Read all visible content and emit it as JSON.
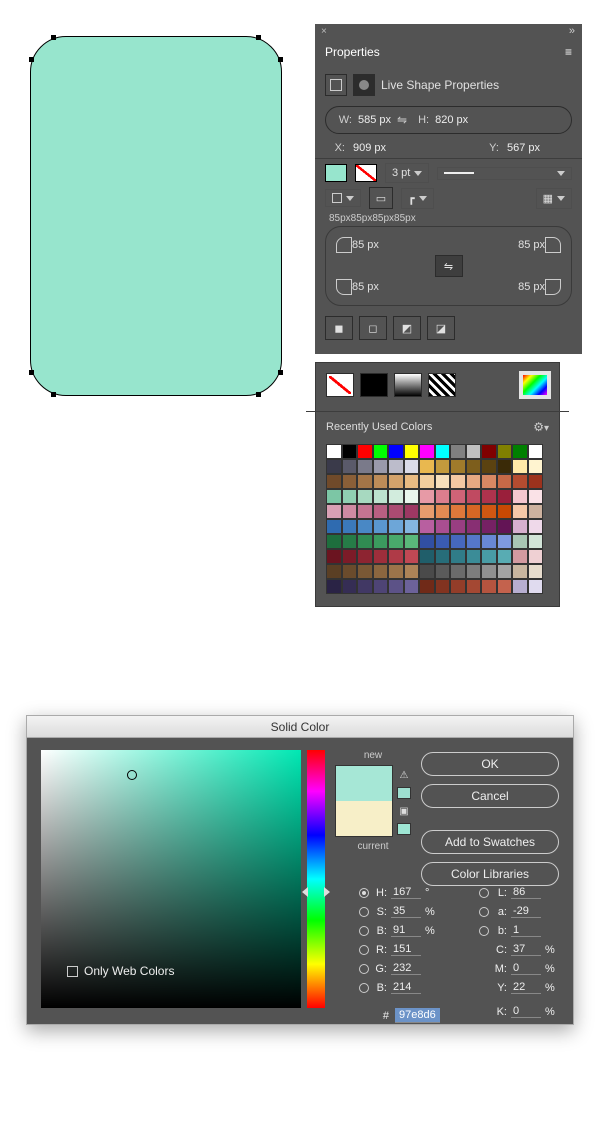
{
  "canvas": {
    "shape_fill": "#97e5cd"
  },
  "properties": {
    "panel_title": "Properties",
    "section_title": "Live Shape Properties",
    "w_label": "W:",
    "w_value": "585 px",
    "h_label": "H:",
    "h_value": "820 px",
    "x_label": "X:",
    "x_value": "909 px",
    "y_label": "Y:",
    "y_value": "567 px",
    "stroke_weight": "3 pt",
    "corner_summary": "85px85px85px85px",
    "corner_tl": "85 px",
    "corner_tr": "85 px",
    "corner_bl": "85 px",
    "corner_br": "85 px"
  },
  "swatches": {
    "recent_label": "Recently Used Colors",
    "rows": [
      [
        "#ffffff",
        "#000000",
        "#ff0000",
        "#00ff00",
        "#0000ff",
        "#ffff00",
        "#ff00ff",
        "#00ffff",
        "#808080",
        "#c0c0c0",
        "#800000",
        "#808000",
        "#008000",
        "#ffffff"
      ],
      [
        "#3a3a4a",
        "#5a5a6a",
        "#7a7a8a",
        "#9a9aab",
        "#bcbccb",
        "#dadbe8",
        "#e9b84f",
        "#c39a3d",
        "#a07b2b",
        "#7d5e1c",
        "#5b4210",
        "#3a2a07",
        "#ffe9a8",
        "#fff4d0"
      ],
      [
        "#704a2a",
        "#8a5f38",
        "#a47547",
        "#bd8c58",
        "#d4a36b",
        "#e9bb82",
        "#f2cf9e",
        "#f7e0bc",
        "#f3c8a2",
        "#e7a982",
        "#d88863",
        "#c76947",
        "#b44c30",
        "#9c321d"
      ],
      [
        "#7cc6a5",
        "#90cfb2",
        "#a7d9c0",
        "#bde3cf",
        "#d2ecdd",
        "#e8f6ec",
        "#e79aa6",
        "#dc7e8e",
        "#cf6377",
        "#c04a61",
        "#ae334d",
        "#9a1f3b",
        "#f4c7cf",
        "#fae2e7"
      ],
      [
        "#d9a0b4",
        "#cf8aa3",
        "#c47492",
        "#b85f82",
        "#ab4b72",
        "#9d3863",
        "#e79c6d",
        "#e38a53",
        "#de783b",
        "#d86725",
        "#d15712",
        "#c84903",
        "#f5c9a8",
        "#cdb29f"
      ],
      [
        "#2f6bb0",
        "#3b79bb",
        "#4988c5",
        "#5a97cf",
        "#6da6d8",
        "#84b6e0",
        "#b85fa0",
        "#a94e91",
        "#993e82",
        "#882f73",
        "#762164",
        "#631455",
        "#d7b0cf",
        "#efd9ea"
      ],
      [
        "#1e6e3d",
        "#267c47",
        "#308b52",
        "#3b9a5e",
        "#49a96b",
        "#5ab87a",
        "#314fa3",
        "#3a5bb1",
        "#4668be",
        "#5577ca",
        "#6888d5",
        "#7f9ae0",
        "#a9c6b4",
        "#d2e4d8"
      ],
      [
        "#6b1420",
        "#7c1b28",
        "#8d2431",
        "#9e2e3b",
        "#af3a47",
        "#c04854",
        "#205e6a",
        "#276d79",
        "#307c88",
        "#3b8c97",
        "#489ca5",
        "#58acb3",
        "#d39aa0",
        "#efd0d3"
      ],
      [
        "#5a3f24",
        "#6a4b2c",
        "#7a5835",
        "#8b663f",
        "#9c744a",
        "#ad8357",
        "#4a4a4a",
        "#5a5a5a",
        "#6b6b6b",
        "#7d7d7d",
        "#909090",
        "#a4a4a4",
        "#c9b6a0",
        "#e7dccd"
      ],
      [
        "#2a2345",
        "#352d54",
        "#413864",
        "#4e4475",
        "#5c5287",
        "#6c629a",
        "#702a18",
        "#823320",
        "#933d29",
        "#a44833",
        "#b4543f",
        "#c4624d",
        "#b7aed0",
        "#e0dbef"
      ]
    ]
  },
  "color_picker": {
    "title": "Solid Color",
    "ok": "OK",
    "cancel": "Cancel",
    "add_swatch": "Add to Swatches",
    "libraries": "Color Libraries",
    "new_label": "new",
    "current_label": "current",
    "new_color": "#a6e7d6",
    "current_color": "#f7efc8",
    "only_web": "Only Web Colors",
    "H": {
      "l": "H:",
      "v": "167",
      "u": "°"
    },
    "S": {
      "l": "S:",
      "v": "35",
      "u": "%"
    },
    "Bh": {
      "l": "B:",
      "v": "91",
      "u": "%"
    },
    "L": {
      "l": "L:",
      "v": "86",
      "u": ""
    },
    "a": {
      "l": "a:",
      "v": "-29",
      "u": ""
    },
    "b": {
      "l": "b:",
      "v": "1",
      "u": ""
    },
    "R": {
      "l": "R:",
      "v": "151",
      "u": ""
    },
    "G": {
      "l": "G:",
      "v": "232",
      "u": ""
    },
    "Bc": {
      "l": "B:",
      "v": "214",
      "u": ""
    },
    "C": {
      "l": "C:",
      "v": "37",
      "u": "%"
    },
    "M": {
      "l": "M:",
      "v": "0",
      "u": "%"
    },
    "Y": {
      "l": "Y:",
      "v": "22",
      "u": "%"
    },
    "K": {
      "l": "K:",
      "v": "0",
      "u": "%"
    },
    "hex_label": "#",
    "hex_value": "97e8d6"
  }
}
